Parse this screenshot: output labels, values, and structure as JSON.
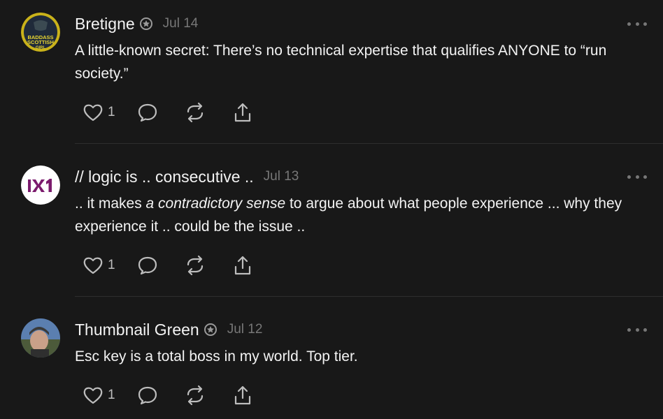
{
  "posts": [
    {
      "author": "Bretigne",
      "verified": true,
      "date": "Jul 14",
      "avatar_icon": "baddass-scottish-girl-avatar",
      "avatar_text": [
        "BADDASS",
        "SCOTTISH",
        "GIRL"
      ],
      "text_parts": [
        "A little-known secret: There’s no technical expertise that qualifies ANYONE to “run society.”"
      ],
      "likes": "1"
    },
    {
      "author": "// logic is .. consecutive ..",
      "verified": false,
      "date": "Jul 13",
      "avatar_icon": "logo-avatar",
      "avatar_text": [
        "IX1"
      ],
      "text_parts": [
        ".. it makes ",
        "a contradictory sense",
        " to argue about what people experience ... why they experience it .. could be the issue .."
      ],
      "likes": "1"
    },
    {
      "author": "Thumbnail Green",
      "verified": true,
      "date": "Jul 12",
      "avatar_icon": "photo-avatar",
      "avatar_text": [],
      "text_parts": [
        "Esc key is a total boss in my world. Top tier."
      ],
      "likes": "1"
    }
  ],
  "icons": {
    "like": "heart-icon",
    "reply": "comment-icon",
    "repost": "repost-icon",
    "share": "share-icon",
    "more": "more-options-icon",
    "verified": "verified-badge-icon"
  },
  "colors": {
    "background": "#181818",
    "text": "#f3f3f3",
    "muted": "#777777",
    "divider": "#2e2e2e",
    "accent_purple": "#7b1b6d"
  }
}
